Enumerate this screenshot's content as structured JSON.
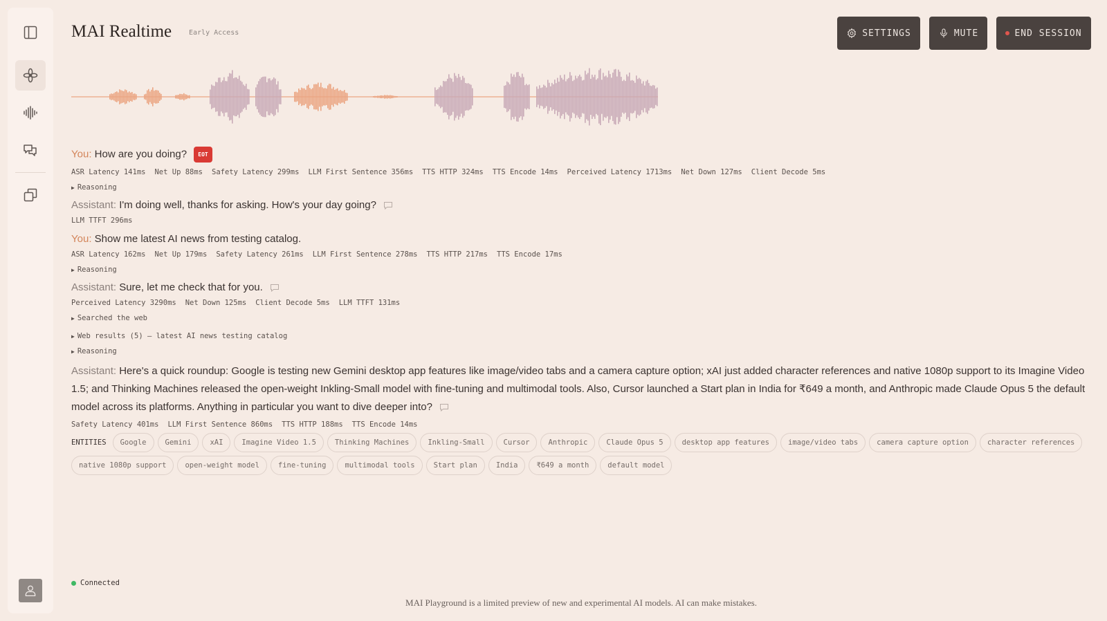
{
  "app": {
    "title": "MAI Realtime",
    "badge": "Early Access"
  },
  "header": {
    "settings_label": "SETTINGS",
    "mute_label": "MUTE",
    "end_session_label": "END SESSION"
  },
  "sidebar": {
    "items": [
      {
        "icon": "sidebar-toggle-icon"
      },
      {
        "icon": "flower-icon",
        "active": true
      },
      {
        "icon": "waveform-icon"
      },
      {
        "icon": "chat-icon"
      },
      {
        "icon": "copy-icon"
      }
    ]
  },
  "turns": [
    {
      "speaker": "You:",
      "text": "How are you doing?",
      "eot": "EOT",
      "metrics": [
        "ASR Latency 141ms",
        "Net Up 88ms",
        "Safety Latency 299ms",
        "LLM First Sentence 356ms",
        "TTS HTTP 324ms",
        "TTS Encode 14ms",
        "Perceived Latency 1713ms",
        "Net Down 127ms",
        "Client Decode 5ms"
      ],
      "toggles": [
        "Reasoning"
      ]
    },
    {
      "speaker": "Assistant:",
      "text": "I'm doing well, thanks for asking. How's your day going?",
      "metrics": [
        "LLM TTFT 296ms"
      ]
    },
    {
      "speaker": "You:",
      "text": "Show me latest AI news from testing catalog.",
      "metrics": [
        "ASR Latency 162ms",
        "Net Up 179ms",
        "Safety Latency 261ms",
        "LLM First Sentence 278ms",
        "TTS HTTP 217ms",
        "TTS Encode 17ms"
      ],
      "toggles": [
        "Reasoning"
      ]
    },
    {
      "speaker": "Assistant:",
      "text": "Sure, let me check that for you.",
      "metrics": [
        "Perceived Latency 3290ms",
        "Net Down 125ms",
        "Client Decode 5ms",
        "LLM TTFT 131ms"
      ],
      "toggles": [
        "Searched the web",
        "Web results (5) — latest AI news testing catalog",
        "Reasoning"
      ]
    },
    {
      "speaker": "Assistant:",
      "text": "Here's a quick roundup: Google is testing new Gemini desktop app features like image/video tabs and a camera capture option; xAI just added character references and native 1080p support to its Imagine Video 1.5; and Thinking Machines released the open-weight Inkling-Small model with fine-tuning and multimodal tools. Also, Cursor launched a Start plan in India for ₹649 a month, and Anthropic made Claude Opus 5 the default model across its platforms. Anything in particular you want to dive deeper into?",
      "metrics": [
        "Safety Latency 401ms",
        "LLM First Sentence 860ms",
        "TTS HTTP 188ms",
        "TTS Encode 14ms"
      ]
    }
  ],
  "entities": {
    "label": "ENTITIES",
    "items": [
      "Google",
      "Gemini",
      "xAI",
      "Imagine Video 1.5",
      "Thinking Machines",
      "Inkling-Small",
      "Cursor",
      "Anthropic",
      "Claude Opus 5",
      "desktop app features",
      "image/video tabs",
      "camera capture option",
      "character references",
      "native 1080p support",
      "open-weight model",
      "fine-tuning",
      "multimodal tools",
      "Start plan",
      "India",
      "₹649 a month",
      "default model"
    ]
  },
  "status": {
    "text": "Connected",
    "color": "#3fb964"
  },
  "footer": {
    "text": "MAI Playground is a limited preview of new and experimental AI models. AI can make mistakes."
  },
  "colors": {
    "background": "#f6ebe4",
    "button": "#4a423f",
    "you_accent": "#d3855a",
    "eot_badge": "#d93a34",
    "wave_user": "#eba582",
    "wave_assistant": "#c9aab7"
  }
}
